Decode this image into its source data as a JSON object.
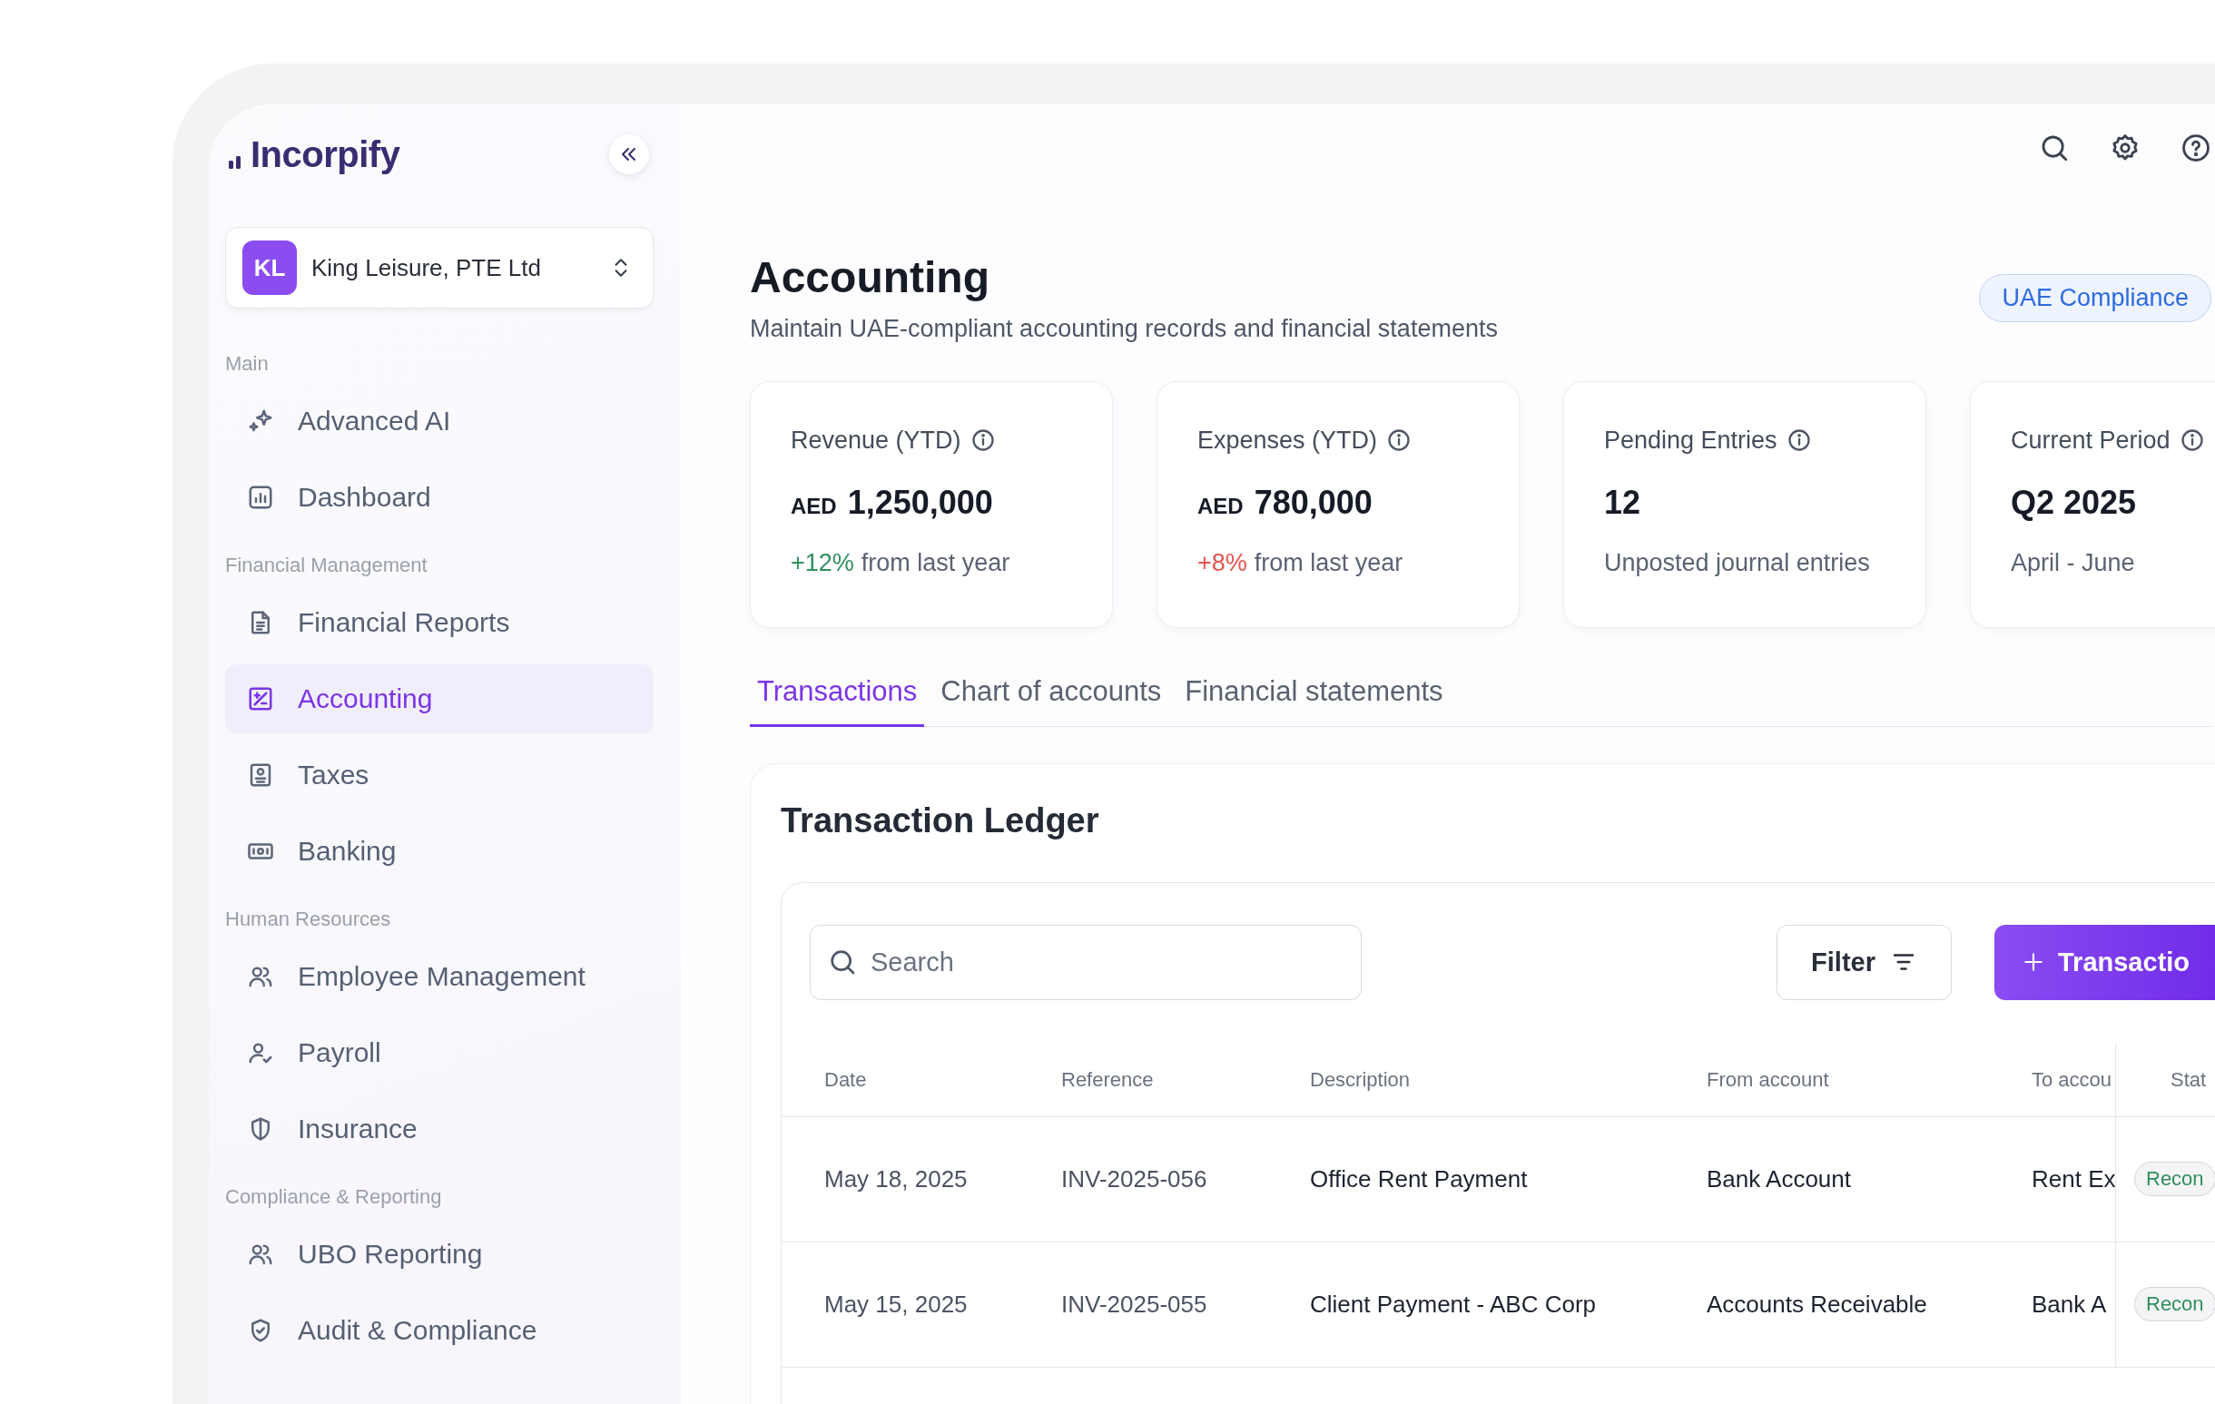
{
  "brand": {
    "name": "Incorpify"
  },
  "company": {
    "initials": "KL",
    "name": "King Leisure, PTE Ltd"
  },
  "sidebar": {
    "sections": [
      {
        "title": "Main",
        "items": [
          {
            "label": "Advanced AI",
            "selected": false
          },
          {
            "label": "Dashboard",
            "selected": false
          }
        ]
      },
      {
        "title": "Financial Management",
        "items": [
          {
            "label": "Financial Reports",
            "selected": false
          },
          {
            "label": "Accounting",
            "selected": true
          },
          {
            "label": "Taxes",
            "selected": false
          },
          {
            "label": "Banking",
            "selected": false
          }
        ]
      },
      {
        "title": "Human Resources",
        "items": [
          {
            "label": "Employee Management",
            "selected": false
          },
          {
            "label": "Payroll",
            "selected": false
          },
          {
            "label": "Insurance",
            "selected": false
          }
        ]
      },
      {
        "title": "Compliance & Reporting",
        "items": [
          {
            "label": "UBO Reporting",
            "selected": false
          },
          {
            "label": "Audit & Compliance",
            "selected": false
          }
        ]
      }
    ]
  },
  "page": {
    "title": "Accounting",
    "subtitle": "Maintain UAE-compliant accounting records and financial statements",
    "badge": "UAE Compliance"
  },
  "stats": [
    {
      "label": "Revenue (YTD)",
      "currency": "AED",
      "value": "1,250,000",
      "change": "+12%",
      "color": "#2f8f5b",
      "note": "from last year"
    },
    {
      "label": "Expenses (YTD)",
      "currency": "AED",
      "value": "780,000",
      "change": "+8%",
      "color": "#e5534b",
      "note": "from last year"
    },
    {
      "label": "Pending Entries",
      "value": "12",
      "note": "Unposted journal entries"
    },
    {
      "label": "Current Period",
      "value": "Q2 2025",
      "note": "April - June"
    }
  ],
  "tabs": [
    {
      "label": "Transactions",
      "selected": true
    },
    {
      "label": "Chart of accounts",
      "selected": false
    },
    {
      "label": "Financial statements",
      "selected": false
    }
  ],
  "ledger": {
    "title": "Transaction Ledger",
    "search": {
      "placeholder": "Search"
    },
    "filter_button": "Filter",
    "add_button": "Transactio",
    "columns": [
      "Date",
      "Reference",
      "Description",
      "From account",
      "To accou",
      "Stat"
    ],
    "rows": [
      {
        "date": "May 18, 2025",
        "reference": "INV-2025-056",
        "description": "Office Rent Payment",
        "from": "Bank Account",
        "to": "Rent Ex",
        "status": "Recon"
      },
      {
        "date": "May 15, 2025",
        "reference": "INV-2025-055",
        "description": "Client Payment - ABC Corp",
        "from": "Accounts Receivable",
        "to": "Bank A",
        "status": "Recon"
      }
    ]
  }
}
